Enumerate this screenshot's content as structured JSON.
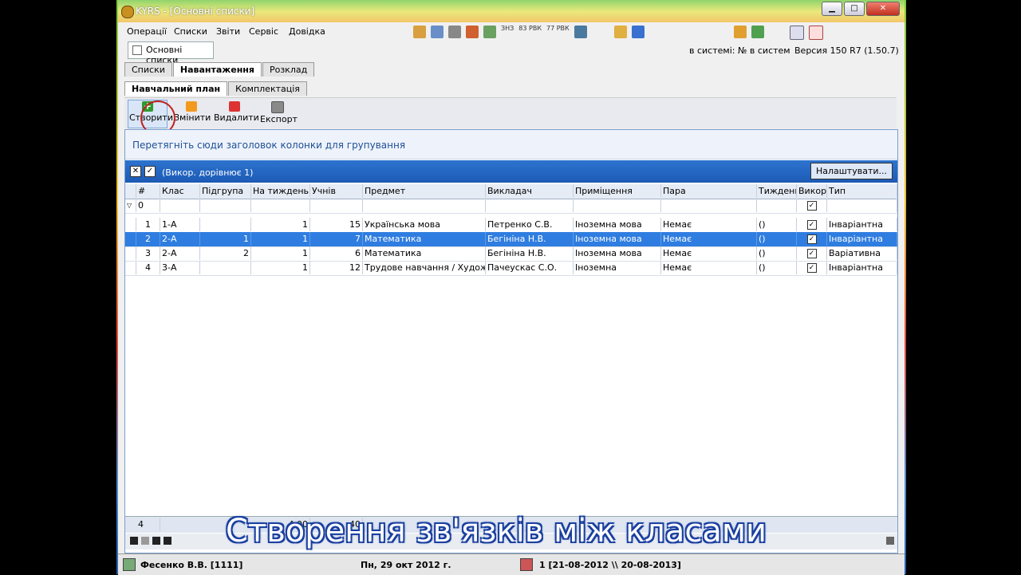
{
  "window": {
    "title": "KYRS - [Основні списки]",
    "min": "▁",
    "max": "□",
    "close": "✕"
  },
  "menu": [
    "Операції",
    "Списки",
    "Звіти",
    "Сервіс",
    "Довідка"
  ],
  "toolbar_text_icons": [
    "ЗНЗ",
    "83 РВК",
    "77 РВК"
  ],
  "doc_tab": {
    "label": "Основні списки"
  },
  "status_sys": "в системі: № в систем",
  "version": "Версия 150 R7 (1.50.7)",
  "tabs": [
    "Списки",
    "Навантаження",
    "Розклад"
  ],
  "subtabs": [
    "Навчальний план",
    "Комплектація"
  ],
  "actions": {
    "create": "Створити",
    "edit": "Змінити",
    "delete": "Видалити",
    "export": "Експорт",
    "create_glyph": "+"
  },
  "group_hint": "Перетягніть сюди заголовок колонки для групування",
  "filter": {
    "text": "(Викор. дорівнює 1)",
    "settings": "Налаштувати...",
    "x": "✕",
    "check": "✓"
  },
  "columns": [
    "#",
    "Клас",
    "Підгрупа",
    "На тиждень (Г",
    "Учнів",
    "Предмет",
    "Викладач",
    "Приміщення",
    "Пара",
    "Тиждень",
    "Викор.",
    "Тип"
  ],
  "filter_row": {
    "num": "0",
    "check": "✓"
  },
  "rows": [
    {
      "n": "1",
      "class": "1-А",
      "sub": "",
      "week": "1",
      "pupils": "15",
      "subject": "Українська мова",
      "teacher": "Петренко С.В.",
      "room": "Іноземна мова",
      "pair": "Немає",
      "weeks": "()",
      "use": "✓",
      "type": "Інваріантна"
    },
    {
      "n": "2",
      "class": "2-А",
      "sub": "1",
      "week": "1",
      "pupils": "7",
      "subject": "Математика",
      "teacher": "Бегініна Н.В.",
      "room": "Іноземна мова",
      "pair": "Немає",
      "weeks": "()",
      "use": "✓",
      "type": "Інваріантна"
    },
    {
      "n": "3",
      "class": "2-А",
      "sub": "2",
      "week": "1",
      "pupils": "6",
      "subject": "Математика",
      "teacher": "Бегініна Н.В.",
      "room": "Іноземна мова",
      "pair": "Немає",
      "weeks": "()",
      "use": "✓",
      "type": "Варіативна"
    },
    {
      "n": "4",
      "class": "3-А",
      "sub": "",
      "week": "1",
      "pupils": "12",
      "subject": "Трудове навчання / Художня",
      "teacher": "Пачеускас С.О.",
      "room": "Іноземна",
      "pair": "Немає",
      "weeks": "()",
      "use": "✓",
      "type": "Інваріантна"
    }
  ],
  "footer": {
    "count": "4",
    "week_sum": "4,00",
    "pupils_sum": "40"
  },
  "caption": "Створення зв'язків між класами",
  "status": {
    "user": "Фесенко В.В. [1111]",
    "date": "Пн, 29 окт 2012 г.",
    "period": "1 [21-08-2012 \\\\ 20-08-2013]"
  }
}
